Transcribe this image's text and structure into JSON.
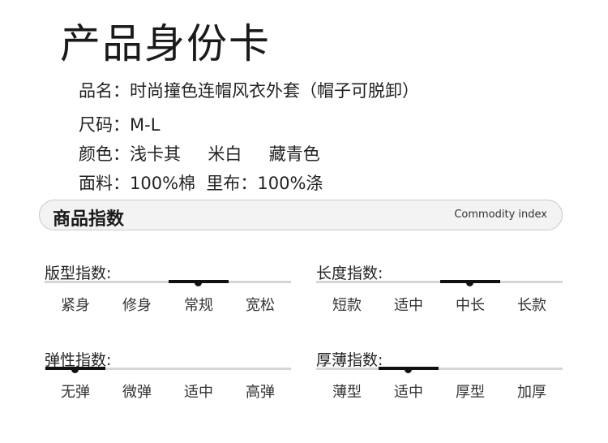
{
  "title": "产品身份卡",
  "info": [
    "品名：时尚撞色连帽风衣外套（帽子可脱卸）",
    "尺码：M-L",
    "颜色：浅卡其     米白     藏青色",
    "面料：100%棉  里布：100%涤"
  ],
  "header": {
    "zh": "商品指数",
    "en": "Commodity index"
  },
  "indices": [
    {
      "label": "版型指数:",
      "options": [
        "紧身",
        "修身",
        "常规",
        "宽松"
      ],
      "selected": 2
    },
    {
      "label": "长度指数:",
      "options": [
        "短款",
        "适中",
        "中长",
        "长款"
      ],
      "selected": 2
    },
    {
      "label": "弹性指数:",
      "options": [
        "无弹",
        "微弹",
        "适中",
        "高弹"
      ],
      "selected": 0
    },
    {
      "label": "厚薄指数:",
      "options": [
        "薄型",
        "适中",
        "厚型",
        "加厚"
      ],
      "selected": 1
    }
  ]
}
